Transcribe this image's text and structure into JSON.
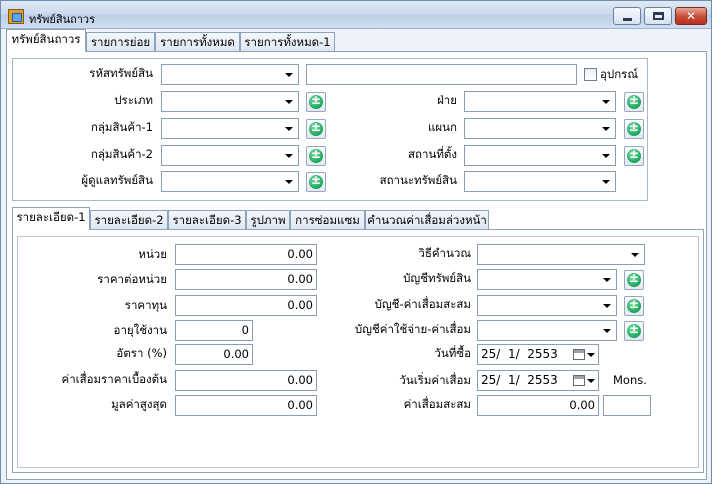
{
  "window": {
    "title": "ทรัพย์สินถาวร"
  },
  "main_tabs": [
    "ทรัพย์สินถาวร",
    "รายการย่อย",
    "รายการทั้งหมด",
    "รายการทั้งหมด-1"
  ],
  "header_form": {
    "asset_code_label": "รหัสทรัพย์สิน",
    "asset_code_value": "",
    "asset_name_value": "",
    "equipment_label": "อุปกรณ์",
    "type_label": "ประเภท",
    "group1_label": "กลุ่มสินค้า-1",
    "group2_label": "กลุ่มสินค้า-2",
    "owner_label": "ผู้ดูแลทรัพย์สิน",
    "division_label": "ฝ่าย",
    "department_label": "แผนก",
    "location_label": "สถานที่ตั้ง",
    "status_label": "สถานะทรัพย์สิน"
  },
  "detail_tabs": [
    "รายละเอียด-1",
    "รายละเอียด-2",
    "รายละเอียด-3",
    "รูปภาพ",
    "การซ่อมแซม",
    "คำนวณค่าเสื่อมล่วงหน้า"
  ],
  "detail": {
    "unit_label": "หน่วย",
    "unit_value": "0.00",
    "unit_price_label": "ราคาต่อหน่วย",
    "unit_price_value": "0.00",
    "cost_label": "ราคาทุน",
    "cost_value": "0.00",
    "life_label": "อายุใช้งาน",
    "life_value": "0",
    "rate_label": "อัตรา (%)",
    "rate_value": "0.00",
    "initial_dep_label": "ค่าเสื่อมราคาเบื้องต้น",
    "initial_dep_value": "0.00",
    "max_value_label": "มูลค่าสูงสุด",
    "max_value_value": "0.00",
    "calc_method_label": "วิธีคำนวณ",
    "asset_account_label": "บัญชีทรัพย์สิน",
    "accum_dep_account_label": "บัญชี-ค่าเสื่อมสะสม",
    "dep_expense_account_label": "บัญชีค่าใช้จ่าย-ค่าเสื่อม",
    "purchase_date_label": "วันที่ซื้อ",
    "purchase_date_value": "25/  1/  2553",
    "dep_start_label": "วันเริ่มค่าเสื่อม",
    "dep_start_value": "25/  1/  2553",
    "mons_label": "Mons.",
    "accum_dep_label": "ค่าเสื่อมสะสม",
    "accum_dep_value": "0.00",
    "mons_value": ""
  }
}
